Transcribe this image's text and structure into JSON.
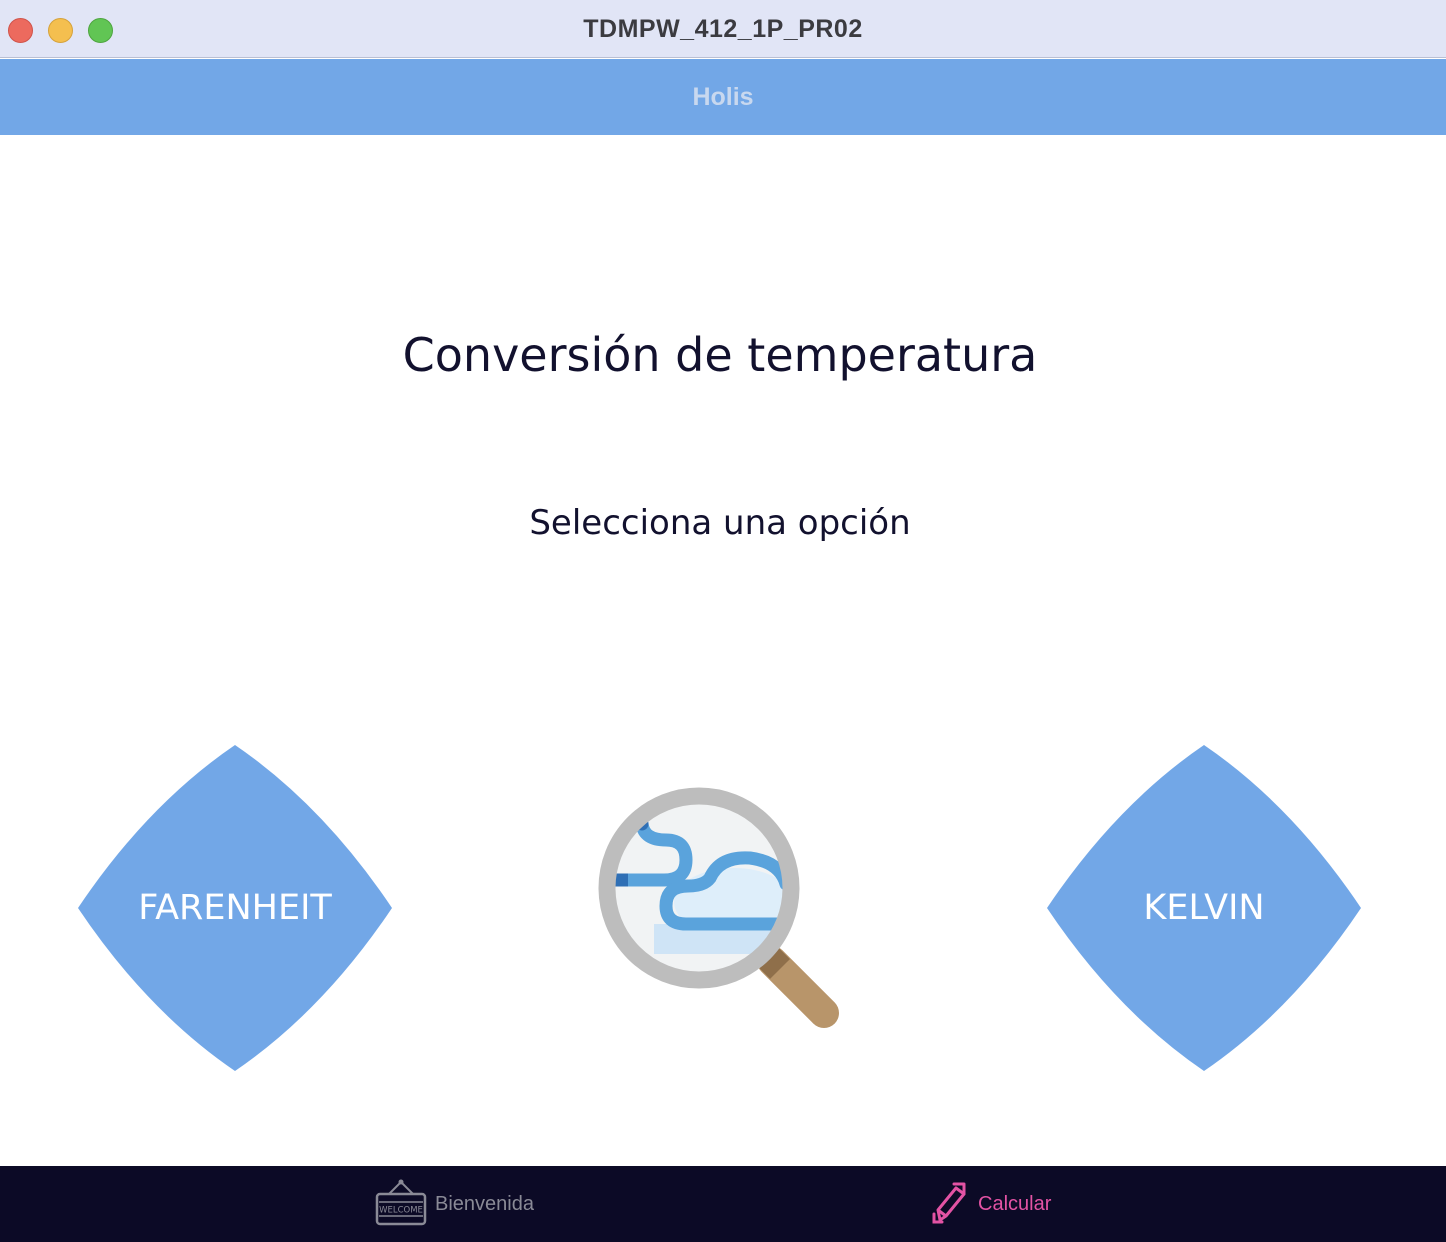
{
  "window": {
    "title": "TDMPW_412_1P_PR02"
  },
  "header": {
    "title": "Holis"
  },
  "main": {
    "title": "Conversión de temperatura",
    "subtitle": "Selecciona una opción",
    "options": [
      {
        "label": "FARENHEIT"
      },
      {
        "label": "KELVIN"
      }
    ],
    "illustration_icon": "magnifying-glass-weather-icon"
  },
  "tabbar": {
    "tabs": [
      {
        "label": "Bienvenida",
        "icon": "welcome-sign-icon",
        "active": false
      },
      {
        "label": "Calcular",
        "icon": "pencil-arrow-icon",
        "active": true
      }
    ]
  },
  "colors": {
    "accent": "#72a7e7",
    "tabbar_bg": "#0c0a26",
    "active_tab": "#e353a4",
    "inactive_tab": "#8a8a96",
    "text_dark": "#12112e"
  }
}
